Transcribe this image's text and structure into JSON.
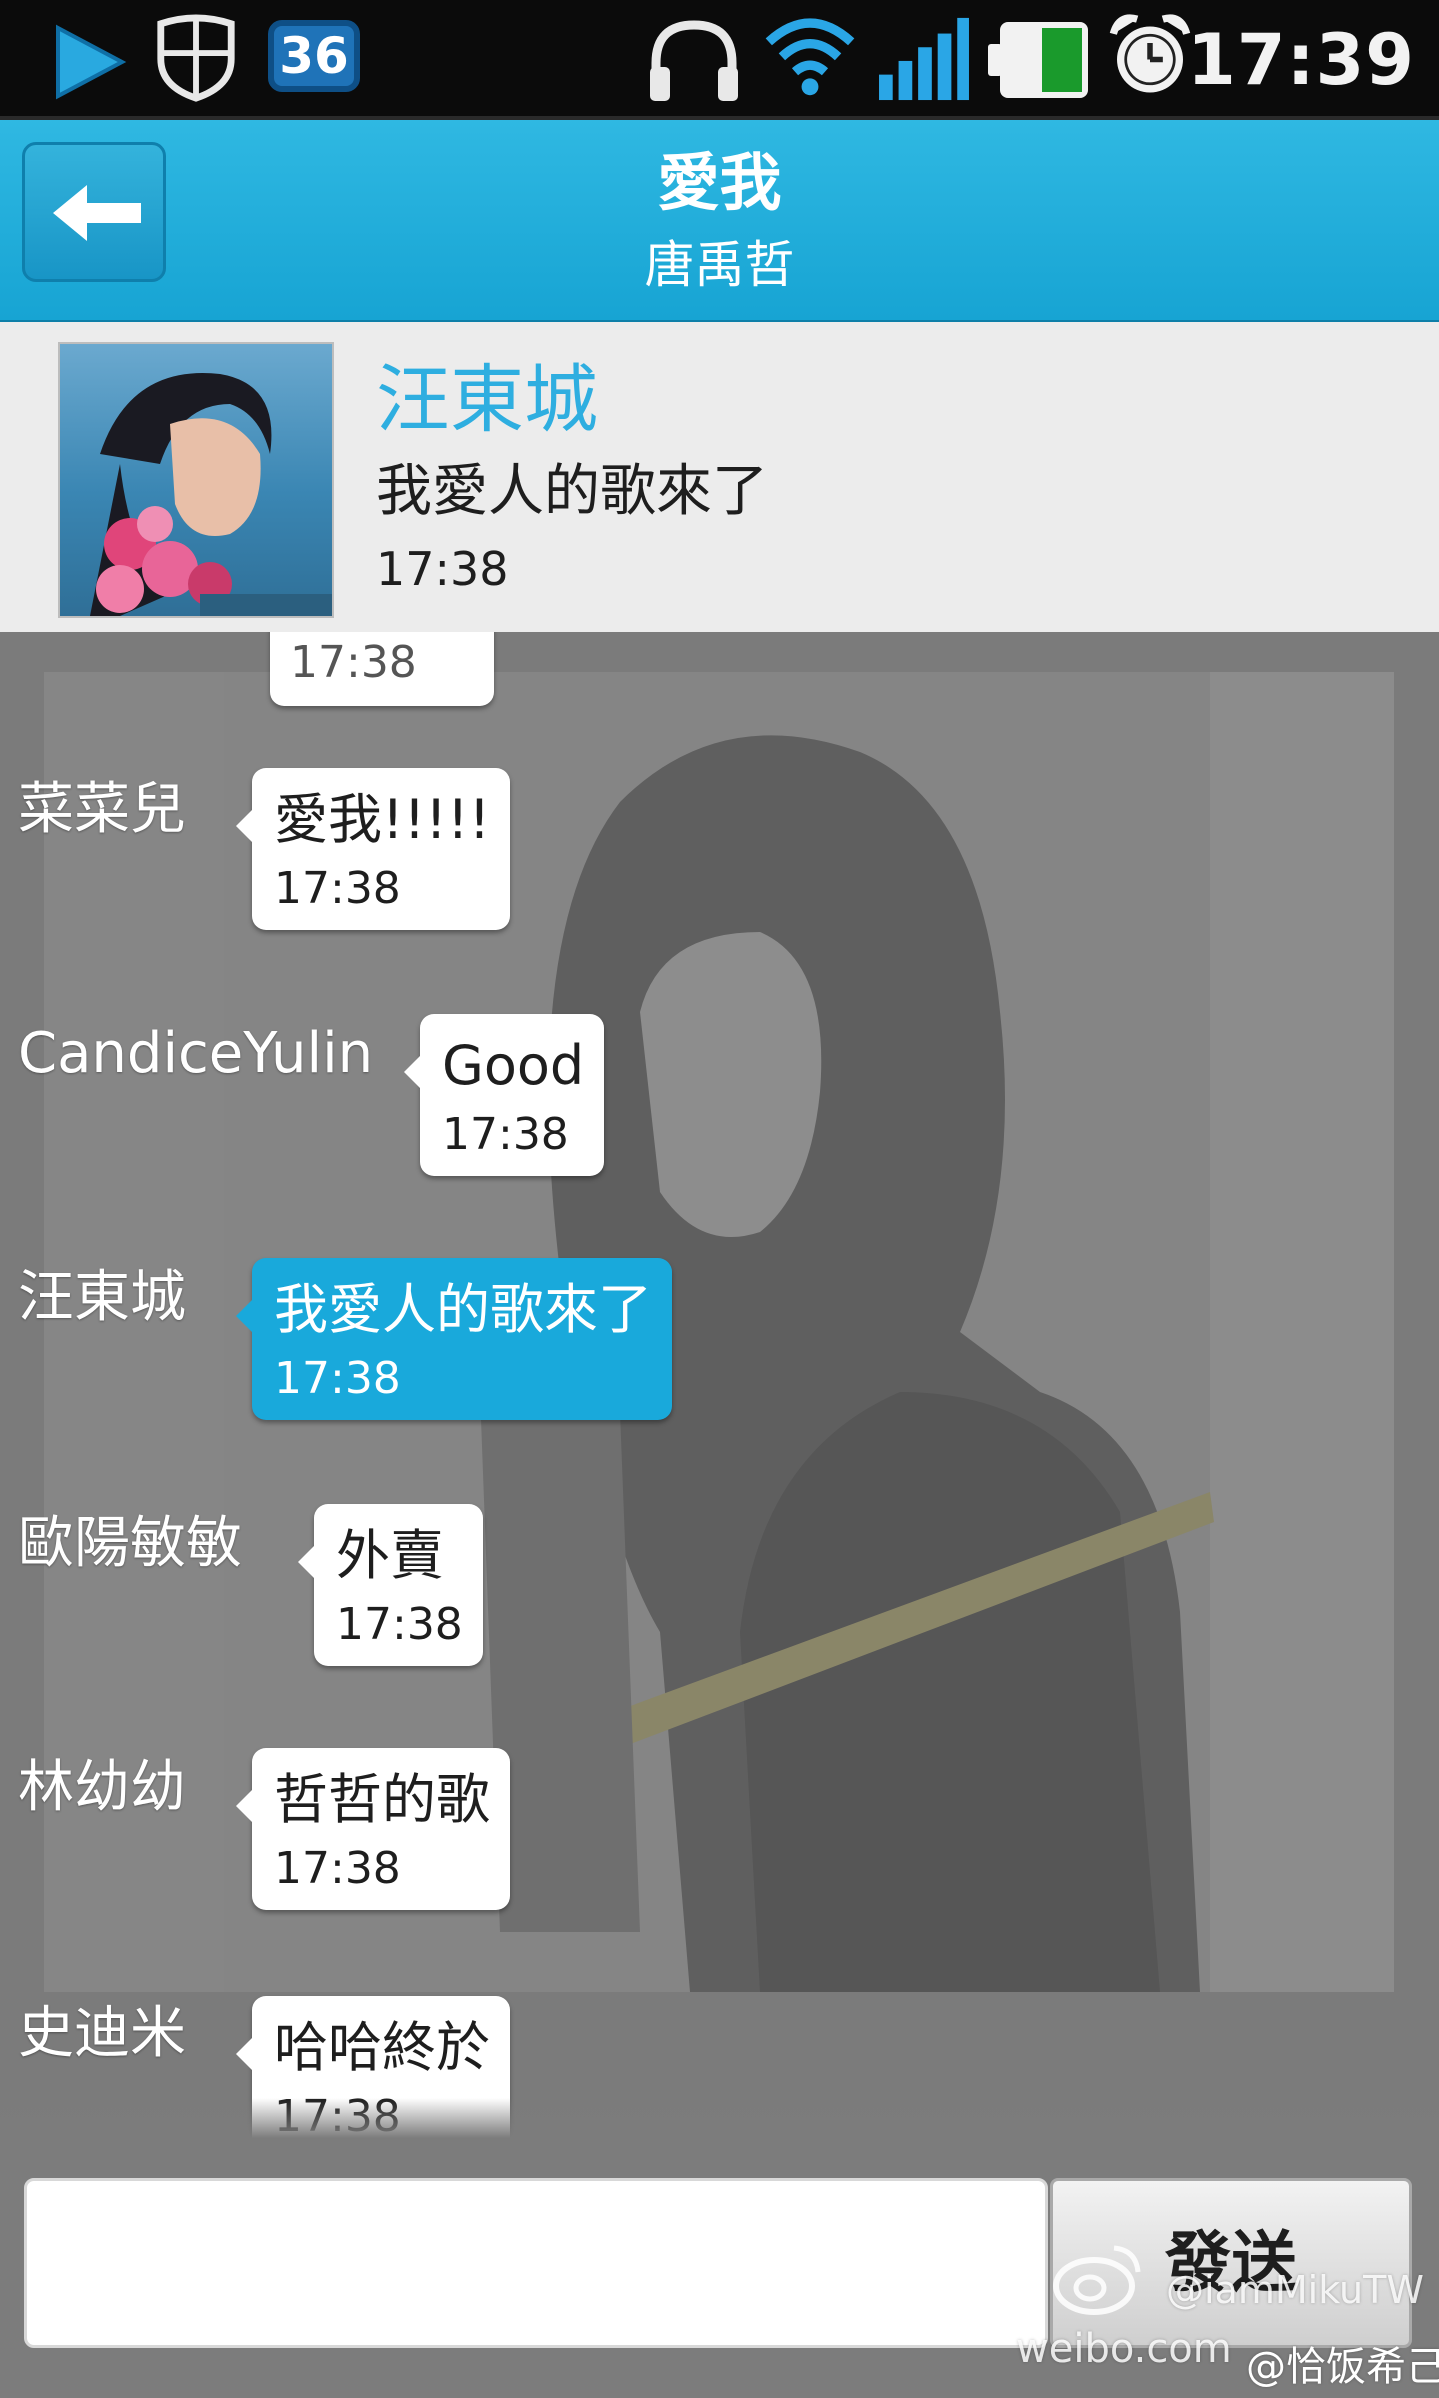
{
  "status_bar": {
    "time": "17:39",
    "notification_count": "36",
    "icons": [
      "play-store-icon",
      "shield-icon",
      "notification-badge",
      "headphones-icon",
      "wifi-icon",
      "signal-icon",
      "battery-icon",
      "alarm-icon"
    ]
  },
  "header": {
    "title": "愛我",
    "subtitle": "唐禹哲",
    "back_icon": "arrow-left-icon",
    "accent_color": "#1aa7d8"
  },
  "pinned_message": {
    "author": "汪東城",
    "text": "我愛人的歌來了",
    "time": "17:38"
  },
  "messages": [
    {
      "author": "",
      "text": "",
      "time": "17:38",
      "partial": true
    },
    {
      "author": "菜菜兒",
      "text": "愛我!!!!!",
      "time": "17:38"
    },
    {
      "author": "CandiceYulin",
      "text": "Good",
      "time": "17:38"
    },
    {
      "author": "汪東城",
      "text": "我愛人的歌來了",
      "time": "17:38",
      "highlight": true
    },
    {
      "author": "歐陽敏敏",
      "text": "外賣",
      "time": "17:38"
    },
    {
      "author": "林幼幼",
      "text": "哲哲的歌",
      "time": "17:38"
    },
    {
      "author": "史迪米",
      "text": "哈哈終於",
      "time": "17:38"
    }
  ],
  "composer": {
    "input_value": "",
    "input_placeholder": "",
    "send_label": "發送"
  },
  "watermarks": {
    "handle": "@iamMikuTW",
    "site": "weibo.com",
    "user": "@恰饭希己"
  },
  "colors": {
    "highlight_bubble": "#19a9db",
    "chat_background": "#7c7c7c",
    "status_bar": "#0b0b0b"
  }
}
